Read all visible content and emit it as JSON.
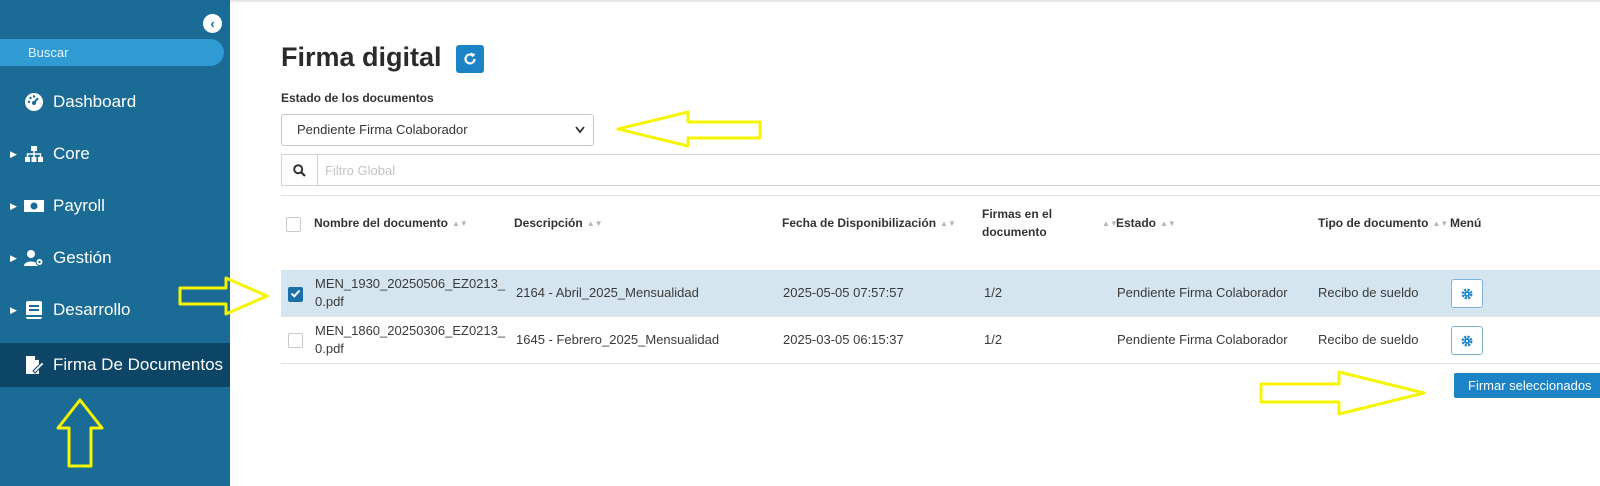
{
  "sidebar": {
    "search_label": "Buscar",
    "items": [
      {
        "label": "Dashboard",
        "icon": "dashboard-gauge-icon",
        "has_caret": false
      },
      {
        "label": "Core",
        "icon": "sitemap-icon",
        "has_caret": true
      },
      {
        "label": "Payroll",
        "icon": "money-bill-icon",
        "has_caret": true
      },
      {
        "label": "Gestión",
        "icon": "users-cog-icon",
        "has_caret": true
      },
      {
        "label": "Desarrollo",
        "icon": "book-icon",
        "has_caret": true
      },
      {
        "label": "Firma De Documentos",
        "icon": "file-signature-icon",
        "has_caret": false,
        "active": true
      }
    ]
  },
  "page": {
    "title": "Firma digital",
    "status_label": "Estado de los documentos",
    "status_selected": "Pendiente Firma Colaborador",
    "filter_placeholder": "Filtro Global"
  },
  "table": {
    "headers": {
      "name": "Nombre del documento",
      "description": "Descripción",
      "date": "Fecha de Disponibilización",
      "signatures_line1": "Firmas en el",
      "signatures_line2": "documento",
      "status": "Estado",
      "type": "Tipo de documento",
      "menu": "Menú"
    },
    "rows": [
      {
        "selected": true,
        "name_line1": "MEN_1930_20250506_EZ0213_",
        "name_line2": "0.pdf",
        "description": "2164 - Abril_2025_Mensualidad",
        "date": "2025-05-05 07:57:57",
        "signatures": "1/2",
        "status": "Pendiente Firma Colaborador",
        "type": "Recibo de sueldo"
      },
      {
        "selected": false,
        "name_line1": "MEN_1860_20250306_EZ0213_",
        "name_line2": "0.pdf",
        "description": "1645 - Febrero_2025_Mensualidad",
        "date": "2025-03-05 06:15:37",
        "signatures": "1/2",
        "status": "Pendiente Firma Colaborador",
        "type": "Recibo de sueldo"
      }
    ]
  },
  "actions": {
    "sign_selected": "Firmar seleccionados"
  },
  "colors": {
    "sidebar": "#1a6b96",
    "sidebar_active": "#0d4566",
    "primary": "#1c84c6",
    "selected_row": "#d5e5ef",
    "annotation": "#f5f500"
  }
}
